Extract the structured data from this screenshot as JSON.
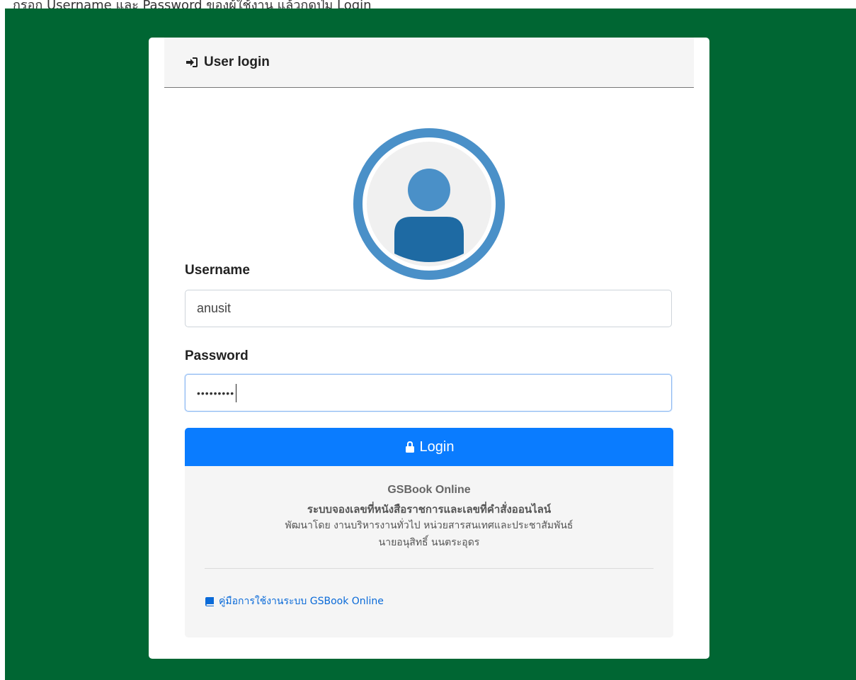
{
  "caption": "กรอก Username และ Password ของผู้ใช้งาน แล้วกดปุ่ม Login",
  "colors": {
    "background": "#006633",
    "button": "#0a7cff",
    "avatar_ring": "#4a90c8"
  },
  "header": {
    "icon": "sign-in-icon",
    "title": "User login"
  },
  "avatar": {
    "icon": "user-avatar-icon"
  },
  "form": {
    "username_label": "Username",
    "username_value": "anusit",
    "password_label": "Password",
    "password_value": "•••••••••"
  },
  "login_button": {
    "icon": "lock-icon",
    "label": "Login"
  },
  "footer": {
    "app_name": "GSBook Online",
    "description": "ระบบจองเลขที่หนังสือราชการและเลขที่คำสั่งออนไลน์",
    "developer": "พัฒนาโดย งานบริหารงานทั่วไป หน่วยสารสนเทศและประชาสัมพันธ์",
    "author": "นายอนุสิทธิ์ นนตระอุดร",
    "manual_icon": "book-icon",
    "manual_link": "คู่มือการใช้งานระบบ GSBook Online"
  }
}
